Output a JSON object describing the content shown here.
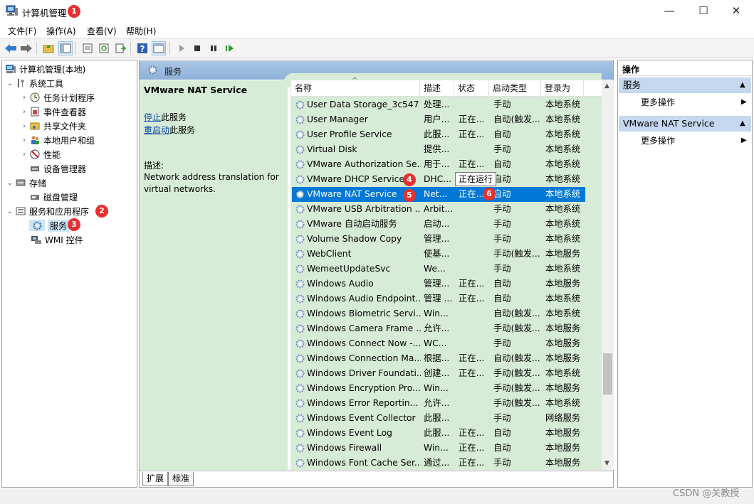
{
  "window": {
    "title": "计算机管理",
    "controls": {
      "minimize": "—",
      "maximize": "☐",
      "close": "✕"
    }
  },
  "badges": [
    "1",
    "2",
    "3",
    "4",
    "5",
    "6"
  ],
  "menu": [
    "文件(F)",
    "操作(A)",
    "查看(V)",
    "帮助(H)"
  ],
  "tree": {
    "root": "计算机管理(本地)",
    "items": [
      {
        "label": "系统工具",
        "icon": "tools-icon"
      },
      {
        "label": "任务计划程序",
        "icon": "clock-icon"
      },
      {
        "label": "事件查看器",
        "icon": "event-viewer-icon"
      },
      {
        "label": "共享文件夹",
        "icon": "shared-folder-icon"
      },
      {
        "label": "本地用户和组",
        "icon": "users-icon"
      },
      {
        "label": "性能",
        "icon": "performance-icon"
      },
      {
        "label": "设备管理器",
        "icon": "device-manager-icon"
      },
      {
        "label": "存储",
        "icon": "storage-icon"
      },
      {
        "label": "磁盘管理",
        "icon": "disk-icon"
      },
      {
        "label": "服务和应用程序",
        "icon": "services-apps-icon"
      },
      {
        "label": "服务",
        "icon": "services-gear-icon"
      },
      {
        "label": "WMI 控件",
        "icon": "wmi-icon"
      }
    ]
  },
  "center": {
    "header": "服务",
    "detail": {
      "service_name": "VMware NAT Service",
      "stop_link": "停止",
      "stop_suffix": "此服务",
      "restart_link": "重启动",
      "restart_suffix": "此服务",
      "desc_label": "描述:",
      "description": "Network address translation for virtual networks."
    },
    "columns": [
      "名称",
      "描述",
      "状态",
      "启动类型",
      "登录为"
    ],
    "tooltip": "正在运行",
    "rows": [
      [
        "User Data Storage_3c547",
        "处理...",
        "",
        "手动",
        "本地系统"
      ],
      [
        "User Manager",
        "用户...",
        "正在...",
        "自动(触发...",
        "本地系统"
      ],
      [
        "User Profile Service",
        "此服...",
        "正在...",
        "自动",
        "本地系统"
      ],
      [
        "Virtual Disk",
        "提供...",
        "",
        "手动",
        "本地系统"
      ],
      [
        "VMware Authorization Se...",
        "用于...",
        "正在...",
        "自动",
        "本地系统"
      ],
      [
        "VMware DHCP Service",
        "DHC...",
        "正在运行",
        "自动",
        "本地系统"
      ],
      [
        "VMware NAT Service",
        "Net...",
        "正在...",
        "自动",
        "本地系统"
      ],
      [
        "VMware USB Arbitration ...",
        "Arbit...",
        "",
        "手动",
        "本地系统"
      ],
      [
        "VMware 自动启动服务",
        "启动...",
        "",
        "手动",
        "本地系统"
      ],
      [
        "Volume Shadow Copy",
        "管理...",
        "",
        "手动",
        "本地系统"
      ],
      [
        "WebClient",
        "使基...",
        "",
        "手动(触发...",
        "本地服务"
      ],
      [
        "WemeetUpdateSvc",
        "We...",
        "",
        "手动",
        "本地系统"
      ],
      [
        "Windows Audio",
        "管理...",
        "正在...",
        "自动",
        "本地服务"
      ],
      [
        "Windows Audio Endpoint...",
        "管理 ...",
        "正在...",
        "自动",
        "本地系统"
      ],
      [
        "Windows Biometric Servi...",
        "Win...",
        "",
        "自动(触发...",
        "本地系统"
      ],
      [
        "Windows Camera Frame ...",
        "允许...",
        "",
        "手动(触发...",
        "本地服务"
      ],
      [
        "Windows Connect Now -...",
        "WC...",
        "",
        "手动",
        "本地服务"
      ],
      [
        "Windows Connection Ma...",
        "根据...",
        "正在...",
        "自动(触发...",
        "本地服务"
      ],
      [
        "Windows Driver Foundati...",
        "创建...",
        "正在...",
        "手动(触发...",
        "本地系统"
      ],
      [
        "Windows Encryption Pro...",
        "Win...",
        "",
        "手动(触发...",
        "本地服务"
      ],
      [
        "Windows Error Reportin...",
        "允许...",
        "",
        "手动(触发...",
        "本地系统"
      ],
      [
        "Windows Event Collector",
        "此服...",
        "",
        "手动",
        "网络服务"
      ],
      [
        "Windows Event Log",
        "此服...",
        "正在...",
        "自动",
        "本地服务"
      ],
      [
        "Windows Firewall",
        "Win...",
        "正在...",
        "自动",
        "本地服务"
      ],
      [
        "Windows Font Cache Ser...",
        "通过...",
        "正在...",
        "手动",
        "本地服务"
      ]
    ],
    "tabs": [
      "扩展",
      "标准"
    ]
  },
  "actions": {
    "title": "操作",
    "groups": [
      {
        "header": "服务",
        "item": "更多操作"
      },
      {
        "header": "VMware NAT Service",
        "item": "更多操作"
      }
    ]
  },
  "watermark": "CSDN @关教授",
  "colors": {
    "accent": "#0078d7",
    "badge": "#e8302f",
    "list_bg": "#d7ecd7",
    "header_bg": "#9ebde0"
  }
}
